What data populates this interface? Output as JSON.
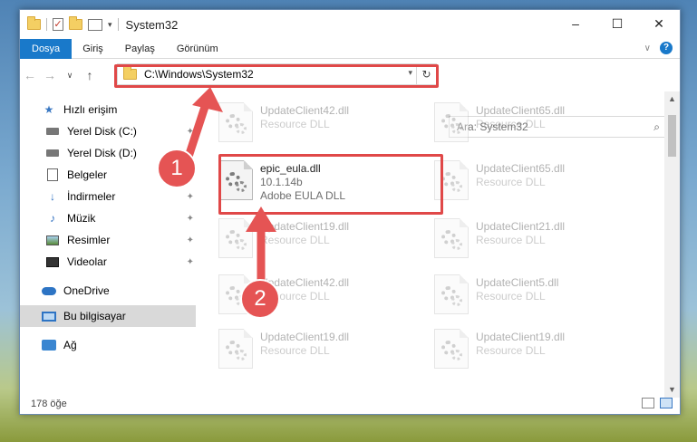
{
  "window": {
    "title": "System32",
    "controls": {
      "minimize": "–",
      "maximize": "☐",
      "close": "✕"
    }
  },
  "ribbon": {
    "tabs": [
      "Dosya",
      "Giriş",
      "Paylaş",
      "Görünüm"
    ]
  },
  "address_bar": {
    "path": "C:\\Windows\\System32"
  },
  "search": {
    "placeholder": "Ara: System32"
  },
  "sidebar": {
    "items": [
      {
        "label": "Hızlı erişim",
        "icon": "star-icon"
      },
      {
        "label": "Yerel Disk (C:)",
        "icon": "drive-icon"
      },
      {
        "label": "Yerel Disk (D:)",
        "icon": "drive-icon"
      },
      {
        "label": "Belgeler",
        "icon": "documents-icon"
      },
      {
        "label": "İndirmeler",
        "icon": "download-icon"
      },
      {
        "label": "Müzik",
        "icon": "music-icon"
      },
      {
        "label": "Resimler",
        "icon": "pictures-icon"
      },
      {
        "label": "Videolar",
        "icon": "videos-icon"
      },
      {
        "label": "OneDrive",
        "icon": "cloud-icon"
      },
      {
        "label": "Bu bilgisayar",
        "icon": "computer-icon"
      },
      {
        "label": "Ağ",
        "icon": "network-icon"
      }
    ]
  },
  "files": [
    {
      "name": "UpdateClient42.dll",
      "desc": "Resource DLL",
      "faded": true
    },
    {
      "name": "UpdateClient65.dll",
      "desc": "Resource DLL",
      "faded": true
    },
    {
      "name": "epic_eula.dll",
      "version": "10.1.14b",
      "desc": "Adobe EULA DLL",
      "faded": false
    },
    {
      "name": "UpdateClient65.dll",
      "desc": "Resource DLL",
      "faded": true
    },
    {
      "name": "UpdateClient19.dll",
      "desc": "Resource DLL",
      "faded": true
    },
    {
      "name": "UpdateClient21.dll",
      "desc": "Resource DLL",
      "faded": true
    },
    {
      "name": "UpdateClient42.dll",
      "desc": "Resource DLL",
      "faded": true
    },
    {
      "name": "UpdateClient5.dll",
      "desc": "Resource DLL",
      "faded": true
    },
    {
      "name": "UpdateClient19.dll",
      "desc": "Resource DLL",
      "faded": true
    },
    {
      "name": "UpdateClient19.dll",
      "desc": "Resource DLL",
      "faded": true
    }
  ],
  "status": {
    "item_count": "178 öğe"
  },
  "annotations": {
    "badge1": "1",
    "badge2": "2",
    "color": "#e55454"
  }
}
